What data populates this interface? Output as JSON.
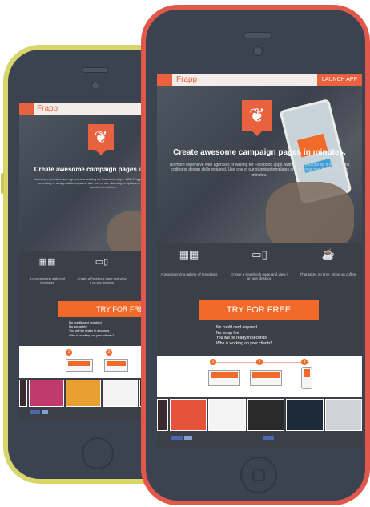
{
  "app": {
    "brand_name": "Frapp",
    "launch_label": "LAUNCH APP",
    "headline": "Create awesome campaign pages in minutes.",
    "subtext": "No more expensive web agencies or waiting for Facebook apps. With Frapp you can do it yourself; no coding or design skills required. Use one of our stunning templates or build your own from scratch in minutes.",
    "features": [
      {
        "icon": "gallery-icon",
        "label": "A programming gallery of templates"
      },
      {
        "icon": "devices-icon",
        "label": "Create a Facebook page and view it on any desktop"
      },
      {
        "icon": "coffee-icon",
        "label": "That takes no time. Bring on coffee."
      }
    ],
    "cta_label": "TRY FOR FREE",
    "checklist": [
      "No credit card required",
      "No setup fee",
      "You will be ready in seconds",
      "Who is working on your clients?"
    ],
    "steps": [
      "1",
      "2",
      "3"
    ]
  },
  "colors": {
    "accent": "#f16a2a",
    "front_frame": "#e2574c",
    "back_frame": "#d8d56b",
    "screen_dark": "#3b4350"
  },
  "thumbnails_front": [
    "#3a2a30",
    "#e8523a",
    "#f4f4f4",
    "#2a2a2a",
    "#1c2a3a",
    "#cfd3d8"
  ],
  "thumbnails_back": [
    "#3a2a30",
    "#c23a6a",
    "#e9a030",
    "#f4f4f4",
    "#2a2a2a",
    "#cfd3d8"
  ]
}
